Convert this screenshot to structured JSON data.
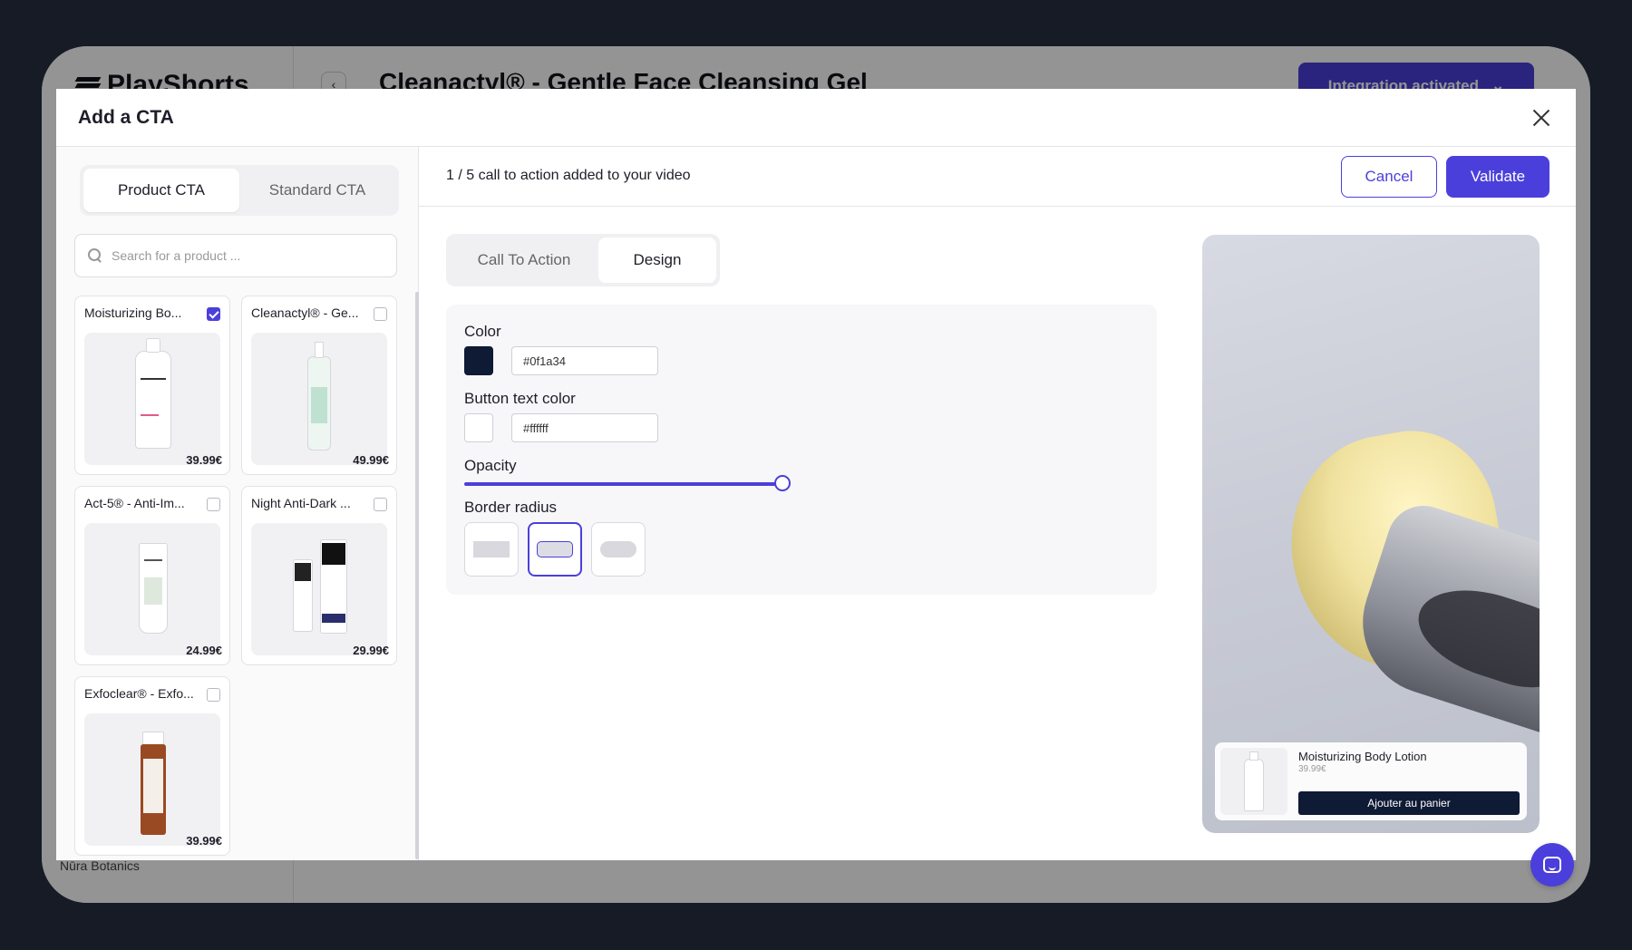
{
  "app": {
    "brand": "PlayShorts",
    "page_title": "Cleanactyl® - Gentle Face Cleansing Gel",
    "integration_label": "Integration activated",
    "org_name": "Nūra Botanics"
  },
  "modal": {
    "title": "Add a CTA",
    "tabs": [
      "Product CTA",
      "Standard CTA"
    ],
    "active_tab": "Product CTA",
    "search_placeholder": "Search for a product ...",
    "products": [
      {
        "name": "Moisturizing Bo...",
        "price": "39.99€",
        "checked": true
      },
      {
        "name": "Cleanactyl® - Ge...",
        "price": "49.99€",
        "checked": false
      },
      {
        "name": "Act-5® - Anti-Im...",
        "price": "24.99€",
        "checked": false
      },
      {
        "name": "Night Anti-Dark ...",
        "price": "29.99€",
        "checked": false
      },
      {
        "name": "Exfoclear® - Exfo...",
        "price": "39.99€",
        "checked": false
      }
    ],
    "cta_count_text": "1 / 5 call to action added to your video",
    "cancel_label": "Cancel",
    "validate_label": "Validate",
    "editor_tabs": [
      "Call To Action",
      "Design"
    ],
    "active_editor_tab": "Design",
    "design": {
      "color_label": "Color",
      "color_value": "#0f1a34",
      "text_color_label": "Button text color",
      "text_color_value": "#ffffff",
      "opacity_label": "Opacity",
      "opacity_value": 1.0,
      "border_radius_label": "Border radius",
      "border_radius_options": [
        "square",
        "rounded",
        "pill"
      ],
      "border_radius_selected": "rounded"
    },
    "preview": {
      "product_name": "Moisturizing Body Lotion",
      "product_price": "39.99€",
      "button_label": "Ajouter au panier"
    }
  },
  "colors": {
    "accent": "#4b3fdb",
    "backdrop": "#161b26"
  }
}
